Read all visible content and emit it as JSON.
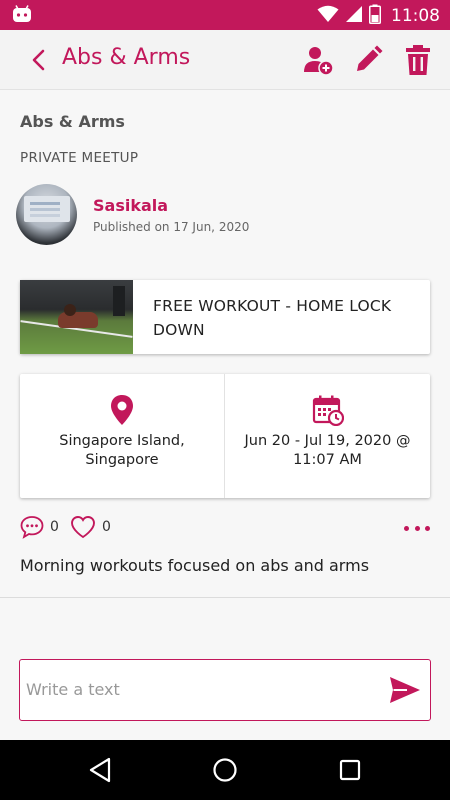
{
  "status_bar": {
    "time": "11:08"
  },
  "app_bar": {
    "title": "Abs & Arms"
  },
  "meetup": {
    "name": "Abs & Arms",
    "type": "PRIVATE MEETUP"
  },
  "author": {
    "name": "Sasikala",
    "published": "Published on 17 Jun, 2020"
  },
  "workout": {
    "title": "FREE WORKOUT - HOME LOCK DOWN"
  },
  "location": {
    "text": "Singapore Island, Singapore"
  },
  "schedule": {
    "text": "Jun 20 - Jul 19, 2020 @ 11:07 AM"
  },
  "stats": {
    "comments": "0",
    "likes": "0"
  },
  "description": "Morning workouts focused on abs and arms",
  "compose": {
    "placeholder": "Write a text",
    "value": ""
  },
  "colors": {
    "accent": "#c2185b",
    "status_bar": "#c2185b",
    "nav_bar": "#000000"
  }
}
